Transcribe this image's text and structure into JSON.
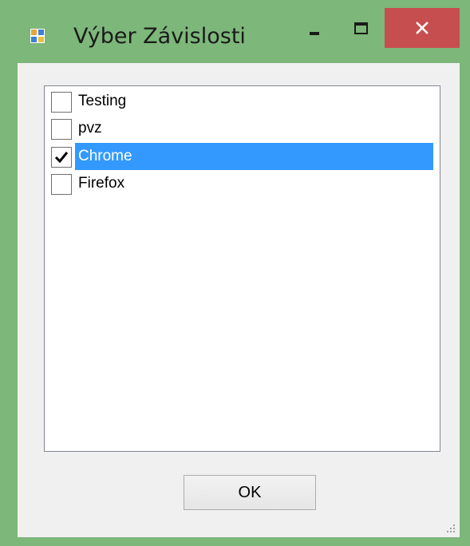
{
  "window": {
    "title": "Výber Závislosti",
    "title_color": "#1a1a1a",
    "frame_color": "#7db77a",
    "close_color": "#c74e4e"
  },
  "titlebar_buttons": {
    "minimize_icon": "minimize-icon",
    "maximize_icon": "maximize-icon",
    "close_icon": "close-icon"
  },
  "list": {
    "items": [
      {
        "label": "Testing",
        "checked": false,
        "selected": false
      },
      {
        "label": "pvz",
        "checked": false,
        "selected": false
      },
      {
        "label": "Chrome",
        "checked": true,
        "selected": true
      },
      {
        "label": "Firefox",
        "checked": false,
        "selected": false
      }
    ],
    "selection_color": "#3399ff"
  },
  "ok_button": {
    "label": "OK"
  }
}
